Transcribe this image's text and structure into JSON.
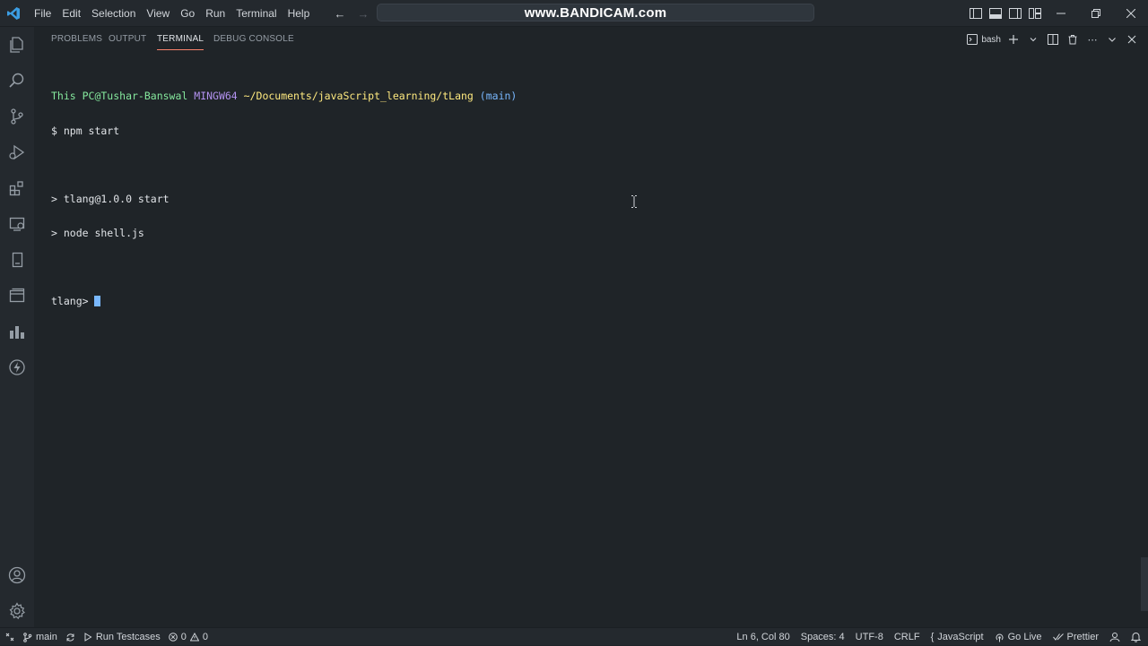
{
  "titlebar": {
    "menu": [
      "File",
      "Edit",
      "Selection",
      "View",
      "Go",
      "Run",
      "Terminal",
      "Help"
    ],
    "watermark": "www.BANDICAM.com"
  },
  "activitybar": {
    "icons": [
      "explorer-icon",
      "search-icon",
      "source-control-icon",
      "run-debug-icon",
      "extensions-icon",
      "remote-explorer-icon",
      "testing-icon",
      "browser-icon",
      "chart-icon",
      "lightning-icon"
    ],
    "bottom_icons": [
      "account-icon",
      "settings-gear-icon"
    ]
  },
  "panel": {
    "tabs": [
      "PROBLEMS",
      "OUTPUT",
      "TERMINAL",
      "DEBUG CONSOLE"
    ],
    "active_tab": "TERMINAL",
    "shell": "bash"
  },
  "terminal": {
    "prompt_user": "This PC@Tushar-Banswal",
    "prompt_system": "MINGW64",
    "prompt_path": "~/Documents/javaScript_learning/tLang",
    "prompt_branch": "(main)",
    "command": "$ npm start",
    "output_1": "> tlang@1.0.0 start",
    "output_2": "> node shell.js",
    "repl_prompt": "tlang> "
  },
  "statusbar": {
    "branch": "main",
    "run_testcases": "Run Testcases",
    "errors": "0",
    "warnings": "0",
    "cursor_pos": "Ln 6, Col 80",
    "spaces": "Spaces: 4",
    "encoding": "UTF-8",
    "eol": "CRLF",
    "language": "JavaScript",
    "go_live": "Go Live",
    "prettier": "Prettier"
  },
  "colors": {
    "background": "#1f2428",
    "chrome": "#24292e",
    "accent_tab": "#f9826c",
    "prompt_green": "#85e89d",
    "prompt_purple": "#b392f0",
    "prompt_yellow": "#ffea7f",
    "cursor_blue": "#79b8ff"
  }
}
